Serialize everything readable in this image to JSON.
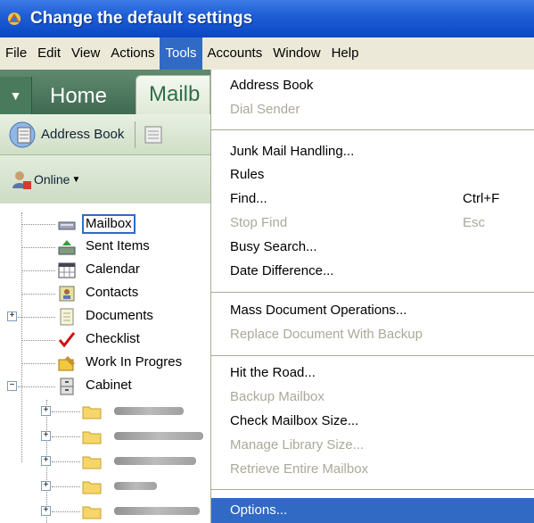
{
  "window": {
    "title": "Change the default settings"
  },
  "menubar": {
    "items": [
      "File",
      "Edit",
      "View",
      "Actions",
      "Tools",
      "Accounts",
      "Window",
      "Help"
    ],
    "active": "Tools"
  },
  "tabs": {
    "home": "Home",
    "mailbox": "Mailb"
  },
  "toolbar": {
    "address_book": "Address Book"
  },
  "status": {
    "online": "Online"
  },
  "tree": {
    "items": [
      "Mailbox",
      "Sent Items",
      "Calendar",
      "Contacts",
      "Documents",
      "Checklist",
      "Work In Progres",
      "Cabinet"
    ]
  },
  "tools_menu": {
    "address_book": "Address Book",
    "dial_sender": "Dial Sender",
    "junk_mail": "Junk Mail Handling...",
    "rules": "Rules",
    "find": "Find...",
    "find_shortcut": "Ctrl+F",
    "stop_find": "Stop Find",
    "stop_find_shortcut": "Esc",
    "busy_search": "Busy Search...",
    "date_difference": "Date Difference...",
    "mass_doc": "Mass Document Operations...",
    "replace_doc": "Replace Document With Backup",
    "hit_road": "Hit the Road...",
    "backup_mailbox": "Backup Mailbox",
    "check_size": "Check Mailbox Size...",
    "manage_library": "Manage Library Size...",
    "retrieve_mailbox": "Retrieve Entire Mailbox",
    "options": "Options..."
  },
  "colors": {
    "title_bar": "#0a47c4",
    "menu_highlight": "#316ac5",
    "disabled_text": "#aca899"
  }
}
